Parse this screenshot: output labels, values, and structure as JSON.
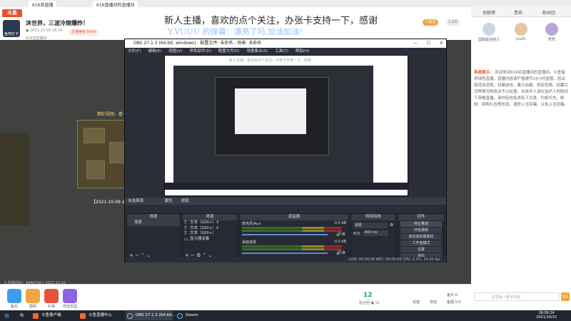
{
  "browser": {
    "tabs": [
      "616亚直播",
      "616直播间的直播间"
    ]
  },
  "header": {
    "logo": "斗鱼",
    "avatar_label": "鱼吧打卡",
    "stream_title": "沐世界，三波冷熔爆炸！",
    "meta": "● 2021-10-09 18:14",
    "info": "616亚直播间",
    "badge": "主播等级 500+",
    "follow_button": "+关注",
    "follow_count": "1.3万"
  },
  "danmu": {
    "line1": "新人主播，喜欢的点个关注，办张卡支持一下，感谢",
    "line2": "Y.VUUU 的弹幕：漂亮了吗,加油加油！"
  },
  "video": {
    "guide_text": "精彩视频，看一遍~",
    "clip_caption": "【2021-10-09 2...",
    "bottom_caption": "0 直播间ID：6848700 | 2021.10.10"
  },
  "right_panel": {
    "tabs": [
      "贡献榜",
      "贵宾",
      "粉丝团"
    ],
    "fans": [
      {
        "name": "国服最强骑士"
      },
      {
        "name": "juu91"
      },
      {
        "name": "秀秀"
      }
    ],
    "notice_label": "系统提示：",
    "notice_text": "欢迎来到616亚直播间的直播间。斗鱼倡导绿色直播，直播内容请严格遵守24小时监管。因出现违法违规、封建迷信、暴力血腥、低俗色情、招募引流等情况将依法予以处置。未成年人请在监护人的陪同下观看直播。请勿轻信各类私下交易、代练代充、刷粉、网购礼包等信息，谨防上当受骗。以免上当受骗。",
    "chat_placeholder": "这里输入聊天内容",
    "send_label": "发送"
  },
  "gift_bar": {
    "gifts": [
      {
        "label": "鱼丸",
        "color": "#3e9cf0"
      },
      {
        "label": "弱鸡",
        "color": "#f0a63e"
      },
      {
        "label": "礼物",
        "color": "#e6523e"
      },
      {
        "label": "夺宝乐园",
        "color": "#8f63e6"
      }
    ],
    "fan_count": "12",
    "fan_label": "粉丝团 ● 12",
    "right_items": [
      "充值",
      "背包",
      "鱼丸 0",
      "鱼翅 0.0"
    ]
  },
  "obs": {
    "title": "OBS 27.1.3 (64-bit, windows) - 配置文件: 未命名 - 场景: 未命名",
    "menu": [
      "文件(F)",
      "编辑(E)",
      "视图(V)",
      "停靠部件(D)",
      "配置文件(P)",
      "场景集合(S)",
      "工具(T)",
      "帮助(H)"
    ],
    "inner_danmu": "新人主播，喜欢的点个关注，办张卡支持一下，感谢",
    "scene_label": "未选择源",
    "preview_tabs": [
      "属性",
      "滤镜"
    ],
    "docks": {
      "scenes": {
        "title": "场景",
        "items": [
          "场景"
        ]
      },
      "sources": {
        "title": "来源",
        "items": [
          "文本（GDI+）3",
          "文本（GDI+）2",
          "文本（GDI+）",
          "显示器采集"
        ]
      },
      "mixer": {
        "title": "混音器",
        "tracks": [
          {
            "name": "麦克风/Aux",
            "db": "0.0 dB"
          },
          {
            "name": "桌面音频",
            "db": "0.0 dB"
          }
        ]
      },
      "transitions": {
        "title": "转场特效",
        "mode": "渐变",
        "duration_label": "时长",
        "duration": "300 ms"
      },
      "controls": {
        "title": "控件",
        "buttons": [
          "停止推流",
          "开始录制",
          "启动虚拟摄像机",
          "工作室模式",
          "设置",
          "退出"
        ]
      }
    },
    "status": "LIVE: 00:00:00   REC: 00:00:00   CPU: 2.3%, 30.00 fps"
  },
  "taskbar": {
    "items": [
      {
        "label": "斗鱼客户端",
        "color": "#f4682b"
      },
      {
        "label": "斗鱼直播中心",
        "color": "#f4682b"
      },
      {
        "label": "OBS 27.1.3 (64-bit...",
        "color": "#383c4a"
      },
      {
        "label": "Steam",
        "color": "#1b2838"
      }
    ],
    "time": "18:06:24",
    "date": "2021/10/10"
  }
}
